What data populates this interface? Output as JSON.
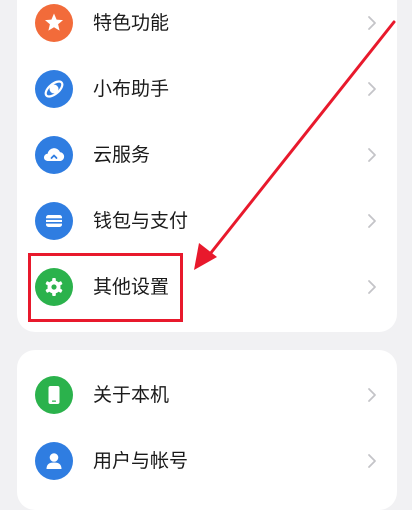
{
  "settings_group_1": {
    "items": [
      {
        "label": "特色功能",
        "icon": "star-icon",
        "color": "#f26b3a"
      },
      {
        "label": "小布助手",
        "icon": "assistant-icon",
        "color": "#2f7de1"
      },
      {
        "label": "云服务",
        "icon": "cloud-icon",
        "color": "#2f7de1"
      },
      {
        "label": "钱包与支付",
        "icon": "wallet-icon",
        "color": "#2f7de1"
      },
      {
        "label": "其他设置",
        "icon": "gear-icon",
        "color": "#2bb24c"
      }
    ]
  },
  "settings_group_2": {
    "items": [
      {
        "label": "关于本机",
        "icon": "phone-icon",
        "color": "#2bb24c"
      },
      {
        "label": "用户与帐号",
        "icon": "user-icon",
        "color": "#2f7de1"
      }
    ]
  },
  "annotation": {
    "highlight_color": "#e8192c",
    "highlighted_item": "其他设置"
  }
}
